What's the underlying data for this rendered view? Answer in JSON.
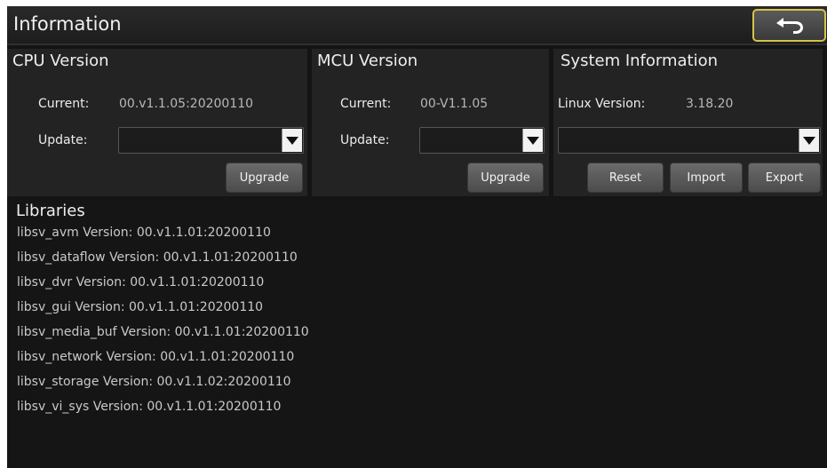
{
  "header": {
    "title": "Information",
    "back_icon": "back-arrow-icon"
  },
  "cpu": {
    "title": "CPU Version",
    "current_label": "Current:",
    "current_value": "00.v1.1.05:20200110",
    "update_label": "Update:",
    "update_value": "",
    "upgrade_label": "Upgrade"
  },
  "mcu": {
    "title": "MCU Version",
    "current_label": "Current:",
    "current_value": "00-V1.1.05",
    "update_label": "Update:",
    "update_value": "",
    "upgrade_label": "Upgrade"
  },
  "system": {
    "title": "System Information",
    "linux_label": "Linux Version:",
    "linux_value": "3.18.20",
    "select_value": "",
    "reset_label": "Reset",
    "import_label": "Import",
    "export_label": "Export"
  },
  "libraries": {
    "title": "Libraries",
    "items": [
      "libsv_avm Version: 00.v1.1.01:20200110",
      "libsv_dataflow Version: 00.v1.1.01:20200110",
      "libsv_dvr Version: 00.v1.1.01:20200110",
      "libsv_gui Version: 00.v1.1.01:20200110",
      "libsv_media_buf Version: 00.v1.1.01:20200110",
      "libsv_network Version: 00.v1.1.01:20200110",
      "libsv_storage Version: 00.v1.1.02:20200110",
      "libsv_vi_sys Version: 00.v1.1.01:20200110"
    ]
  }
}
